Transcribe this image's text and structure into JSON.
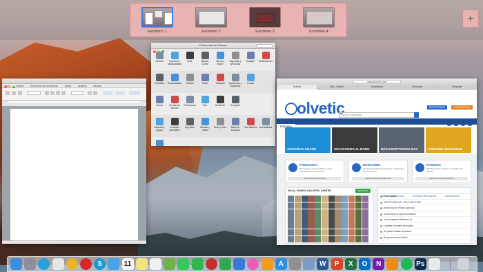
{
  "spaces": [
    {
      "label": "Escritorio 1",
      "active": true
    },
    {
      "label": "Escritorio 2",
      "active": false
    },
    {
      "label": "Escritorio 3",
      "active": false
    },
    {
      "label": "Escritorio 4",
      "active": false
    }
  ],
  "add_space_label": "+",
  "word": {
    "tabs": [
      "Inicio",
      "Diseño",
      "Elementos de documento",
      "Tablas",
      "Gráficos",
      "Revisar"
    ]
  },
  "prefs": {
    "title": "Preferencias del Sistema",
    "rows": [
      [
        "General",
        "Escritorio y salvapantallas",
        "Dock",
        "Mission Control",
        "Idioma y región",
        "Seguridad y privacidad",
        "Spotlight",
        "Notificaciones"
      ],
      [
        "Pantallas",
        "Economizador",
        "Teclado",
        "Ratón",
        "Trackpad",
        "Impresoras y escáneres",
        "Sonido"
      ],
      [
        "iCloud",
        "Cuentas de Internet",
        "Extensiones",
        "Red",
        "Bluetooth",
        "Compartir"
      ],
      [
        "Usuarios y grupos",
        "Controles parentales",
        "App Store",
        "Dictado y habla",
        "Fecha y hora",
        "Disco de arranque",
        "Time Machine",
        "Accesibilidad"
      ],
      [
        "Flash Player"
      ]
    ]
  },
  "safari": {
    "url": "www.solvetic.com",
    "tabs": [
      "Solvetic",
      "Mac - Solvetic",
      "Estadísticas",
      "Soluciones",
      "Preguntas"
    ],
    "logo": "olvetic",
    "search_placeholder": "Buscar soluciones...",
    "top_buttons": [
      "REGISTRARSE",
      "INICIAR SESIÓN"
    ],
    "nav": [
      "PORTADA",
      "ARTÍCULOS",
      "TUTORIALES",
      "REVIEWS",
      "DESCARGAS",
      "COMUNIDAD ▾"
    ],
    "tiles": [
      {
        "caption": "ANTIVIRUS GRATIS",
        "color": "#1e8fd6"
      },
      {
        "caption": "SOLUCIONES AL ROBO",
        "color": "#3b3b3b"
      },
      {
        "caption": "MÁS ESCRITORIOS MAC",
        "color": "#5a6470"
      },
      {
        "caption": "APRENDE SEGURIDAD",
        "color": "#e2a51f"
      }
    ],
    "cards": [
      {
        "title": "PREGUNTA!",
        "desc": "Pide ayuda a la comunidad y recibe respuestas de los expertos",
        "button": "REALIZAR PREGUNTA"
      },
      {
        "title": "RESPONDE",
        "desc": "Ayuda respondiendo preguntas y obteniendo reconocimiento",
        "button": "PREGUNTAS PENDIENTES"
      },
      {
        "title": "RANKING",
        "desc": "Ranking de los expertos y miembros de Solvetic",
        "button": "RANKING DE EXPERTOS"
      }
    ],
    "members_title": "HOLA, SOMOS SOLVETIC ¡ÚNETE!",
    "register_label": "REGISTRO",
    "side_tabs": [
      "PREGUNTAS ACTIVAS",
      "ÚLTIMAS PREGUNTAS",
      "CATEGORÍAS"
    ],
    "side_rows": [
      "Primo update",
      "OFFICE 2011 NOT LOGS OR CLOSE",
      "Borrar todo en iPhone para otro",
      "Cómo limpio la lista de contactos",
      "Cómo instalar el Windows 10",
      "Cambiar el nombre de usuario",
      "No puedo instalar impresora",
      "Recuperar archivo Word"
    ]
  },
  "dock_apps": [
    {
      "name": "finder-icon",
      "color": "#3b8de0"
    },
    {
      "name": "launchpad-icon",
      "color": "#8a8f99"
    },
    {
      "name": "safari-icon",
      "color": "#2a9fd8"
    },
    {
      "name": "photos-icon",
      "color": "#e6e6e6"
    },
    {
      "name": "chrome-icon",
      "color": "#e9b429"
    },
    {
      "name": "opera-icon",
      "color": "#d8262b"
    },
    {
      "name": "skype-icon",
      "color": "#1a9bd7"
    },
    {
      "name": "tweetbot-icon",
      "color": "#47a4e8"
    },
    {
      "name": "calendar-icon",
      "color": "#f5f5f5"
    },
    {
      "name": "notes-icon",
      "color": "#f4e27c"
    },
    {
      "name": "reminders-icon",
      "color": "#f0f0f0"
    },
    {
      "name": "maps-icon",
      "color": "#6db24b"
    },
    {
      "name": "messages-icon",
      "color": "#34c759"
    },
    {
      "name": "facetime-icon",
      "color": "#2fb84f"
    },
    {
      "name": "photo-booth-icon",
      "color": "#c72e2e"
    },
    {
      "name": "numbers-icon",
      "color": "#2fa84f"
    },
    {
      "name": "keynote-icon",
      "color": "#3a78d6"
    },
    {
      "name": "itunes-icon",
      "color": "#ec5bb8"
    },
    {
      "name": "ibooks-icon",
      "color": "#f29b21"
    },
    {
      "name": "app-store-icon",
      "color": "#2e8fe0"
    },
    {
      "name": "system-preferences-icon",
      "color": "#8e8e93"
    },
    {
      "name": "preview-icon",
      "color": "#7a9cc4"
    },
    {
      "name": "word-icon",
      "color": "#2b5797"
    },
    {
      "name": "powerpoint-icon",
      "color": "#d24726"
    },
    {
      "name": "excel-icon",
      "color": "#1f7244"
    },
    {
      "name": "outlook-icon",
      "color": "#0072c6"
    },
    {
      "name": "onenote-icon",
      "color": "#7719aa"
    },
    {
      "name": "vlc-icon",
      "color": "#f28a12"
    },
    {
      "name": "spotify-icon",
      "color": "#1db954"
    },
    {
      "name": "photoshop-icon",
      "color": "#0d2d4f"
    },
    {
      "name": "textedit-icon",
      "color": "#e9e9e9"
    },
    {
      "name": "trash-icon",
      "color": "#cfd3d8"
    }
  ]
}
